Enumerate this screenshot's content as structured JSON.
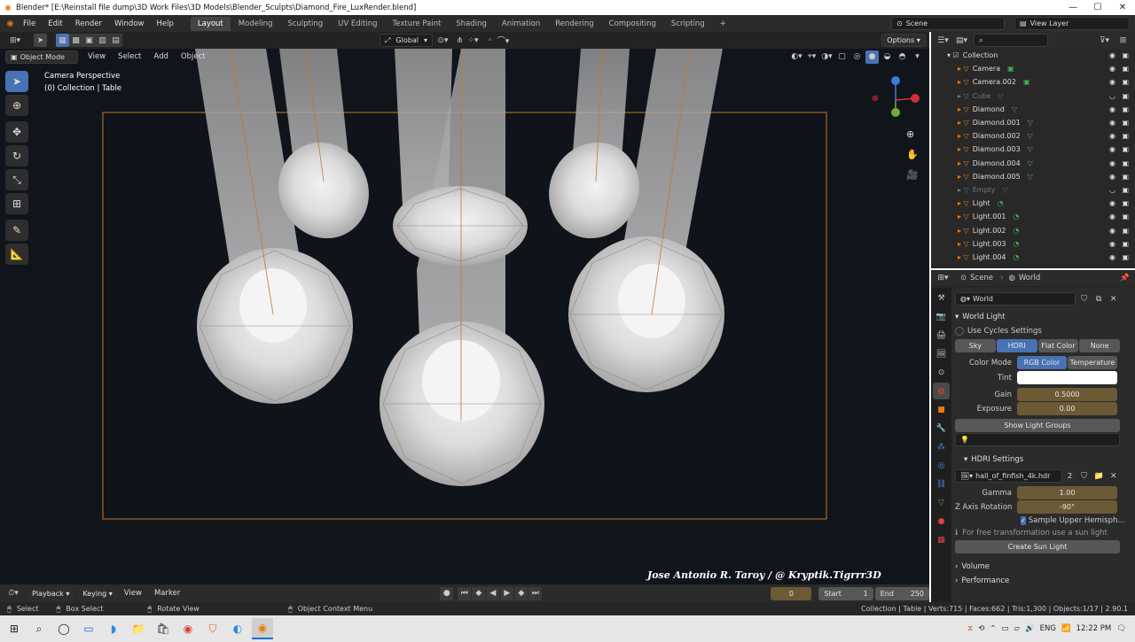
{
  "window": {
    "title": "Blender* [E:\\Reinstall file dump\\3D Work Files\\3D Models\\Blender_Sculpts\\Diamond_Fire_LuxRender.blend]"
  },
  "menus": [
    "File",
    "Edit",
    "Render",
    "Window",
    "Help"
  ],
  "workspaces": [
    "Layout",
    "Modeling",
    "Sculpting",
    "UV Editing",
    "Texture Paint",
    "Shading",
    "Animation",
    "Rendering",
    "Compositing",
    "Scripting"
  ],
  "active_workspace": "Layout",
  "scene": {
    "name": "Scene",
    "view_layer": "View Layer"
  },
  "viewport_header": {
    "mode": "Object Mode",
    "menus": [
      "View",
      "Select",
      "Add",
      "Object"
    ],
    "orientation": "Global",
    "options": "Options"
  },
  "viewport": {
    "perspective": "Camera Perspective",
    "collection_info": "(0) Collection | Table",
    "watermark": "Jose Antonio R. Taroy / @ Kryptik.Tigrrr3D"
  },
  "outliner": {
    "items": [
      {
        "name": "Collection",
        "type": "collection",
        "dim": false
      },
      {
        "name": "Camera",
        "type": "camera",
        "dim": false
      },
      {
        "name": "Camera.002",
        "type": "camera",
        "dim": false
      },
      {
        "name": "Cube",
        "type": "mesh",
        "dim": true
      },
      {
        "name": "Diamond",
        "type": "mesh",
        "dim": false
      },
      {
        "name": "Diamond.001",
        "type": "mesh",
        "dim": false
      },
      {
        "name": "Diamond.002",
        "type": "mesh",
        "dim": false
      },
      {
        "name": "Diamond.003",
        "type": "mesh",
        "dim": false
      },
      {
        "name": "Diamond.004",
        "type": "mesh",
        "dim": false
      },
      {
        "name": "Diamond.005",
        "type": "mesh",
        "dim": false
      },
      {
        "name": "Empty",
        "type": "empty",
        "dim": true
      },
      {
        "name": "Light",
        "type": "light",
        "dim": false
      },
      {
        "name": "Light.001",
        "type": "light",
        "dim": false
      },
      {
        "name": "Light.002",
        "type": "light",
        "dim": false
      },
      {
        "name": "Light.003",
        "type": "light",
        "dim": false
      },
      {
        "name": "Light.004",
        "type": "light",
        "dim": false
      }
    ]
  },
  "properties": {
    "breadcrumb_scene": "Scene",
    "breadcrumb_world": "World",
    "world_field": "World",
    "panel_title": "World Light",
    "use_cycles": "Use Cycles Settings",
    "modes": [
      "Sky",
      "HDRI",
      "Flat Color",
      "None"
    ],
    "active_mode": "HDRI",
    "color_mode_label": "Color Mode",
    "color_modes": [
      "RGB Color",
      "Temperature"
    ],
    "active_color_mode": "RGB Color",
    "tint_label": "Tint",
    "gain_label": "Gain",
    "gain_value": "0.5000",
    "exposure_label": "Exposure",
    "exposure_value": "0.00",
    "show_light_groups": "Show Light Groups",
    "hdri_settings_title": "HDRI Settings",
    "hdri_file": "hall_of_finfish_4k.hdr",
    "hdri_users": "2",
    "gamma_label": "Gamma",
    "gamma_value": "1.00",
    "zrot_label": "Z Axis Rotation",
    "zrot_value": "-90°",
    "sample_upper": "Sample Upper Hemisph...",
    "info_text": "For free transformation use a sun light",
    "create_sun": "Create Sun Light",
    "volume": "Volume",
    "performance": "Performance"
  },
  "timeline": {
    "playback": "Playback",
    "keying": "Keying",
    "view": "View",
    "marker": "Marker",
    "current_frame": "0",
    "start_label": "Start",
    "start_value": "1",
    "end_label": "End",
    "end_value": "250"
  },
  "statusbar": {
    "select": "Select",
    "box_select": "Box Select",
    "rotate_view": "Rotate View",
    "context_menu": "Object Context Menu",
    "stats": "Collection | Table | Verts:715 | Faces:662 | Tris:1,300 | Objects:1/17 | 2.90.1"
  },
  "taskbar": {
    "lang": "ENG",
    "time": "12:22 PM"
  },
  "colors": {
    "accent": "#4772b3",
    "orange": "#e87d0d",
    "green": "#4caf50",
    "field_gold": "#6b5a35"
  }
}
